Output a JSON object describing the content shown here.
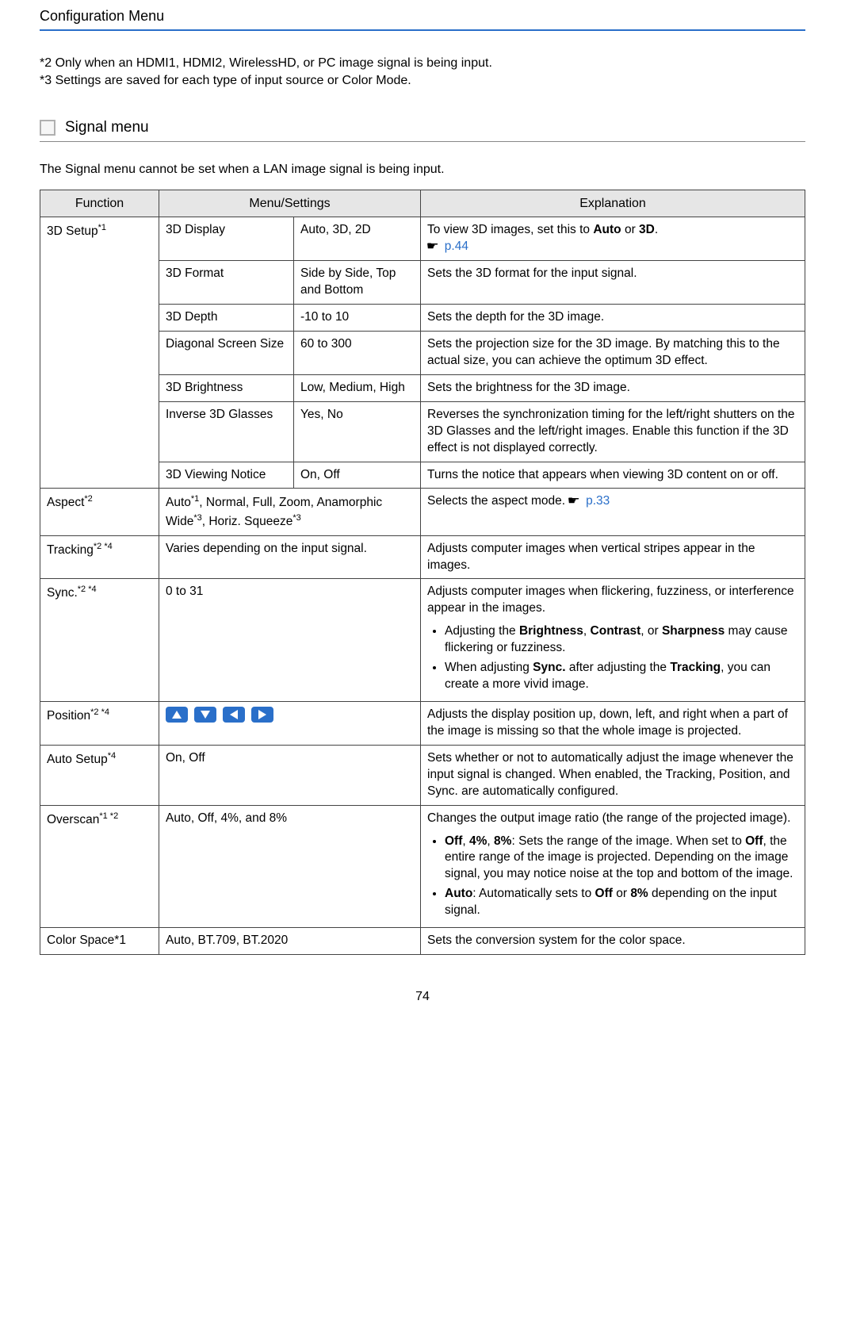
{
  "header": {
    "title": "Configuration Menu"
  },
  "footnotes": {
    "f2": "*2 Only when an HDMI1, HDMI2, WirelessHD, or PC image signal is being input.",
    "f3": "*3 Settings are saved for each type of input source or Color Mode."
  },
  "section": {
    "title": "Signal menu",
    "lead": "The Signal menu cannot be set when a LAN image signal is being input."
  },
  "columns": {
    "fn": "Function",
    "menu": "Menu/Settings",
    "exp": "Explanation"
  },
  "labels": {
    "setup3d": "3D Setup",
    "setup3d_sup": "*1",
    "aspect": "Aspect",
    "aspect_sup": "*2",
    "tracking": "Tracking",
    "tracking_sup": "*2 *4",
    "sync": "Sync.",
    "sync_sup": "*2 *4",
    "position": "Position",
    "position_sup": "*2 *4",
    "autosetup": "Auto Setup",
    "autosetup_sup": "*4",
    "overscan": "Overscan",
    "overscan_sup": "*1 *2",
    "colorspace": "Color Space*1"
  },
  "rows": {
    "r1": {
      "menu": "3D Display",
      "setting": "Auto, 3D, 2D",
      "exp_pre": "To view 3D images, set this to ",
      "exp_b1": "Auto",
      "exp_mid": " or ",
      "exp_b2": "3D",
      "exp_post": ".",
      "ref": "p.44"
    },
    "r2": {
      "menu": "3D Format",
      "setting": "Side by Side, Top and Bottom",
      "exp": "Sets the 3D format for the input signal."
    },
    "r3": {
      "menu": "3D Depth",
      "setting": "-10 to 10",
      "exp": "Sets the depth for the 3D image."
    },
    "r4": {
      "menu": "Diagonal Screen Size",
      "setting": "60 to 300",
      "exp": "Sets the projection size for the 3D image. By matching this to the actual size, you can achieve the optimum 3D effect."
    },
    "r5": {
      "menu": "3D Brightness",
      "setting": "Low, Medium, High",
      "exp": "Sets the brightness for the 3D image."
    },
    "r6": {
      "menu": "Inverse 3D Glasses",
      "setting": "Yes, No",
      "exp": "Reverses the synchronization timing for the left/right shutters on the 3D Glasses and the left/right images. Enable this function if the 3D effect is not displayed correctly."
    },
    "r7": {
      "menu": "3D Viewing Notice",
      "setting": "On, Off",
      "exp": "Turns the notice that appears when viewing 3D content on or off."
    },
    "aspect": {
      "menu_pre": "Auto",
      "menu_sup1": "*1",
      "menu_mid1": ", Normal, Full, Zoom, Anamorphic Wide",
      "menu_sup2": "*3",
      "menu_mid2": ", Horiz. Squeeze",
      "menu_sup3": "*3",
      "exp_pre": "Selects the aspect mode. ",
      "ref": "p.33"
    },
    "tracking": {
      "menu": "Varies depending on the input signal.",
      "exp": "Adjusts computer images when vertical stripes appear in the images."
    },
    "sync": {
      "menu": "0 to 31",
      "exp_line": "Adjusts computer images when flickering, fuzziness, or interference appear in the images.",
      "b1_pre": "Adjusting the ",
      "b1_b1": "Brightness",
      "b1_mid1": ", ",
      "b1_b2": "Contrast",
      "b1_mid2": ", or ",
      "b1_b3": "Sharpness",
      "b1_post": " may cause flickering or fuzziness.",
      "b2_pre": "When adjusting ",
      "b2_b1": "Sync.",
      "b2_mid": " after adjusting the ",
      "b2_b2": "Tracking",
      "b2_post": ", you can create a more vivid image."
    },
    "position": {
      "exp": "Adjusts the display position up, down, left, and right when a part of the image is missing so that the whole image is projected."
    },
    "autosetup": {
      "menu": "On, Off",
      "exp": "Sets whether or not to automatically adjust the image whenever the input signal is changed. When enabled, the Tracking, Position, and Sync. are automatically configured."
    },
    "overscan": {
      "menu": "Auto, Off, 4%, and 8%",
      "exp_line": "Changes the output image ratio (the range of the projected image).",
      "b1_b1": "Off",
      "b1_s1": ", ",
      "b1_b2": "4%",
      "b1_s2": ", ",
      "b1_b3": "8%",
      "b1_mid1": ": Sets the range of the image. When set to ",
      "b1_b4": "Off",
      "b1_mid2": ", the entire range of the image is projected. Depending on the image signal, you may notice noise at the top and bottom of the image.",
      "b2_b1": "Auto",
      "b2_mid": ": Automatically sets to ",
      "b2_b2": "Off",
      "b2_or": " or ",
      "b2_b3": "8%",
      "b2_post": " depending on the input signal."
    },
    "colorspace": {
      "menu": "Auto, BT.709, BT.2020",
      "exp": "Sets the conversion system for the color space."
    }
  },
  "icons": {
    "up": "arrow-up-icon",
    "down": "arrow-down-icon",
    "left": "arrow-left-icon",
    "right": "arrow-right-icon"
  },
  "page_num": "74",
  "chart_data": {
    "type": "table",
    "title": "Signal menu",
    "columns": [
      "Function",
      "Menu/Settings (item)",
      "Menu/Settings (value)",
      "Explanation"
    ],
    "rows": [
      [
        "3D Setup*1",
        "3D Display",
        "Auto, 3D, 2D",
        "To view 3D images, set this to Auto or 3D. → p.44"
      ],
      [
        "3D Setup*1",
        "3D Format",
        "Side by Side, Top and Bottom",
        "Sets the 3D format for the input signal."
      ],
      [
        "3D Setup*1",
        "3D Depth",
        "-10 to 10",
        "Sets the depth for the 3D image."
      ],
      [
        "3D Setup*1",
        "Diagonal Screen Size",
        "60 to 300",
        "Sets the projection size for the 3D image. By matching this to the actual size, you can achieve the optimum 3D effect."
      ],
      [
        "3D Setup*1",
        "3D Brightness",
        "Low, Medium, High",
        "Sets the brightness for the 3D image."
      ],
      [
        "3D Setup*1",
        "Inverse 3D Glasses",
        "Yes, No",
        "Reverses the synchronization timing for the left/right shutters on the 3D Glasses and the left/right images. Enable this function if the 3D effect is not displayed correctly."
      ],
      [
        "3D Setup*1",
        "3D Viewing Notice",
        "On, Off",
        "Turns the notice that appears when viewing 3D content on or off."
      ],
      [
        "Aspect*2",
        "Auto*1, Normal, Full, Zoom, Anamorphic Wide*3, Horiz. Squeeze*3",
        "",
        "Selects the aspect mode. → p.33"
      ],
      [
        "Tracking*2 *4",
        "Varies depending on the input signal.",
        "",
        "Adjusts computer images when vertical stripes appear in the images."
      ],
      [
        "Sync.*2 *4",
        "0 to 31",
        "",
        "Adjusts computer images when flickering, fuzziness, or interference appear in the images. • Adjusting the Brightness, Contrast, or Sharpness may cause flickering or fuzziness. • When adjusting Sync. after adjusting the Tracking, you can create a more vivid image."
      ],
      [
        "Position*2 *4",
        "▲ ▼ ◀ ▶",
        "",
        "Adjusts the display position up, down, left, and right when a part of the image is missing so that the whole image is projected."
      ],
      [
        "Auto Setup*4",
        "On, Off",
        "",
        "Sets whether or not to automatically adjust the image whenever the input signal is changed. When enabled, the Tracking, Position, and Sync. are automatically configured."
      ],
      [
        "Overscan*1 *2",
        "Auto, Off, 4%, and 8%",
        "",
        "Changes the output image ratio (the range of the projected image). • Off, 4%, 8%: Sets the range of the image. When set to Off, the entire range of the image is projected. Depending on the image signal, you may notice noise at the top and bottom of the image. • Auto: Automatically sets to Off or 8% depending on the input signal."
      ],
      [
        "Color Space*1",
        "Auto, BT.709, BT.2020",
        "",
        "Sets the conversion system for the color space."
      ]
    ]
  }
}
